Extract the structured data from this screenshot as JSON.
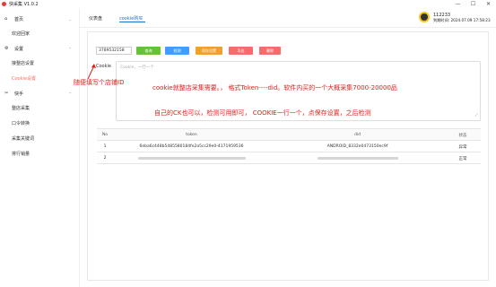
{
  "app": {
    "title": "快采集 V1.0.2"
  },
  "window_controls": {
    "minimize": "—",
    "maximize": "☐",
    "close": "✕"
  },
  "sidebar": {
    "groups": [
      {
        "label": "首页",
        "icon": "home-icon",
        "glyph": "⌂",
        "items": [
          "欢迎回家"
        ]
      },
      {
        "label": "设置",
        "icon": "gear-icon",
        "glyph": "⚙",
        "items": [
          "接整店设置",
          "Cookie设置"
        ]
      },
      {
        "label": "快手",
        "icon": "kuaishou-icon",
        "glyph": "✂",
        "items": [
          "整店采集",
          "口令转换",
          "采集关键词",
          "排行销量"
        ]
      }
    ],
    "active_item": "Cookie设置"
  },
  "header": {
    "tabs": [
      "仪表盘",
      "cookie购买"
    ],
    "active_tab": "cookie购买",
    "user": {
      "id": "112233",
      "expiry": "到期时间: 2024.07.09 17:58:23"
    }
  },
  "toolbar": {
    "shop_id_value": "3789532158",
    "buttons": [
      {
        "label": "查询",
        "color": "#67c23a"
      },
      {
        "label": "检测",
        "color": "#409eff"
      },
      {
        "label": "保存设置",
        "color": "#f0a030"
      },
      {
        "label": "导出",
        "color": "#f56c6c"
      },
      {
        "label": "删除",
        "color": "#f56c6c"
      }
    ]
  },
  "cookie": {
    "label": "Cookie",
    "placeholder": "Cookie，一行一个"
  },
  "annotations": {
    "shop_hint": "随便填写个店铺ID",
    "line1": "cookie就整店采集需要。，  格式Token----did。软件内买的一个大概采集7000-20000品",
    "line2": "自己的CK也可以，检测可用即可，    COOKIE一行一个，点保存设置，之后检测"
  },
  "table": {
    "columns": [
      "No",
      "token",
      "did",
      "状态"
    ],
    "rows": [
      {
        "no": "1",
        "token": "6eba6c448b5485580184fe2a5cc29e0-4171959536",
        "did": "ANDROID_8332e0473150ec9f",
        "status": "异常"
      },
      {
        "no": "2",
        "token": "",
        "did": "",
        "status": "正常"
      }
    ]
  },
  "colors": {
    "accent": "#1f6fd1",
    "active_menu": "#ff6f61",
    "annotation": "#e0201b"
  }
}
